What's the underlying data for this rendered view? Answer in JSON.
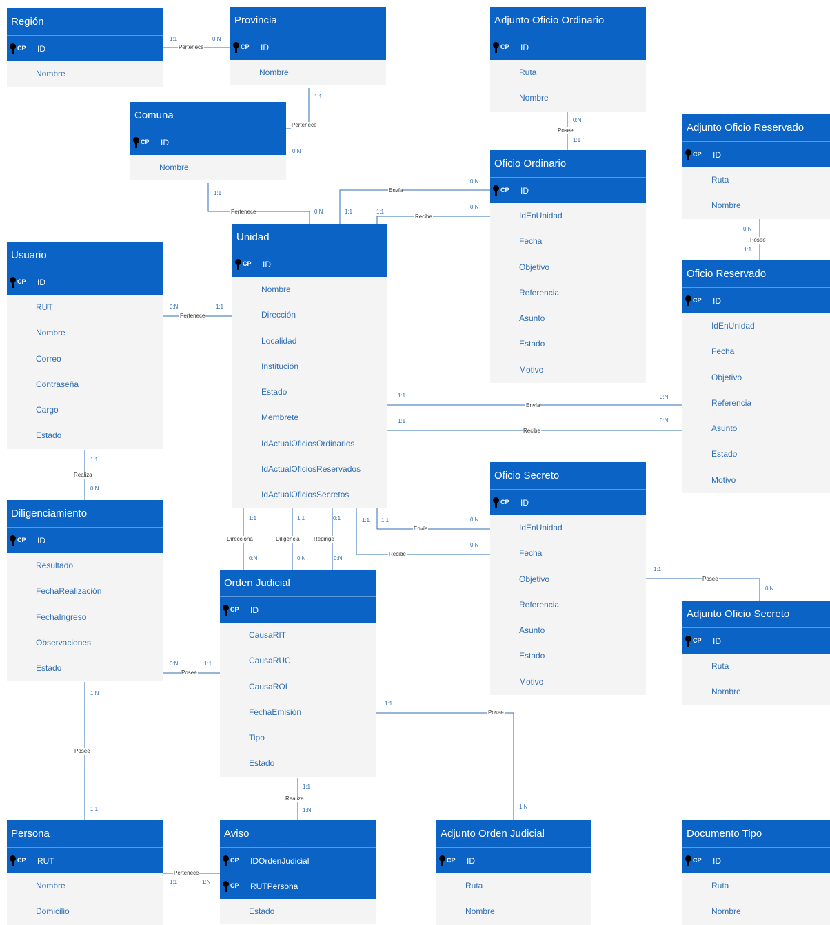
{
  "entities": [
    {
      "id": "region",
      "title": "Región",
      "pk": [
        "ID"
      ],
      "attrs": [
        "Nombre"
      ]
    },
    {
      "id": "provincia",
      "title": "Provincia",
      "pk": [
        "ID"
      ],
      "attrs": [
        "Nombre"
      ]
    },
    {
      "id": "adj_ord",
      "title": "Adjunto Oficio Ordinario",
      "pk": [
        "ID"
      ],
      "attrs": [
        "Ruta",
        "Nombre"
      ]
    },
    {
      "id": "comuna",
      "title": "Comuna",
      "pk": [
        "ID"
      ],
      "attrs": [
        "Nombre"
      ]
    },
    {
      "id": "adj_res",
      "title": "Adjunto Oficio Reservado",
      "pk": [
        "ID"
      ],
      "attrs": [
        "Ruta",
        "Nombre"
      ]
    },
    {
      "id": "of_ord",
      "title": "Oficio Ordinario",
      "pk": [
        "ID"
      ],
      "attrs": [
        "IdEnUnidad",
        "Fecha",
        "Objetivo",
        "Referencia",
        "Asunto",
        "Estado",
        "Motivo"
      ]
    },
    {
      "id": "unidad",
      "title": "Unidad",
      "pk": [
        "ID"
      ],
      "attrs": [
        "Nombre",
        "Dirección",
        "Localidad",
        "Institución",
        "Estado",
        "Membrete",
        "IdActualOficiosOrdinarios",
        "IdActualOficiosReservados",
        "IdActualOficiosSecretos"
      ]
    },
    {
      "id": "usuario",
      "title": "Usuario",
      "pk": [
        "ID"
      ],
      "attrs": [
        "RUT",
        "Nombre",
        "Correo",
        "Contraseña",
        "Cargo",
        "Estado"
      ]
    },
    {
      "id": "of_res",
      "title": "Oficio Reservado",
      "pk": [
        "ID"
      ],
      "attrs": [
        "IdEnUnidad",
        "Fecha",
        "Objetivo",
        "Referencia",
        "Asunto",
        "Estado",
        "Motivo"
      ]
    },
    {
      "id": "of_sec",
      "title": "Oficio Secreto",
      "pk": [
        "ID"
      ],
      "attrs": [
        "IdEnUnidad",
        "Fecha",
        "Objetivo",
        "Referencia",
        "Asunto",
        "Estado",
        "Motivo"
      ]
    },
    {
      "id": "dilig",
      "title": "Diligenciamiento",
      "pk": [
        "ID"
      ],
      "attrs": [
        "Resultado",
        "FechaRealización",
        "FechaIngreso",
        "Observaciones",
        "Estado"
      ]
    },
    {
      "id": "orden",
      "title": "Orden Judicial",
      "pk": [
        "ID"
      ],
      "attrs": [
        "CausaRIT",
        "CausaRUC",
        "CausaROL",
        "FechaEmisión",
        "Tipo",
        "Estado"
      ]
    },
    {
      "id": "adj_sec",
      "title": "Adjunto Oficio Secreto",
      "pk": [
        "ID"
      ],
      "attrs": [
        "Ruta",
        "Nombre"
      ]
    },
    {
      "id": "persona",
      "title": "Persona",
      "pk": [
        "RUT"
      ],
      "attrs": [
        "Nombre",
        "Domicilio"
      ]
    },
    {
      "id": "aviso",
      "title": "Aviso",
      "pk": [
        "IDOrdenJudicial",
        "RUTPersona"
      ],
      "attrs": [
        "Estado"
      ]
    },
    {
      "id": "adj_orden",
      "title": "Adjunto Orden Judicial",
      "pk": [
        "ID"
      ],
      "attrs": [
        "Ruta",
        "Nombre"
      ]
    },
    {
      "id": "doc_tipo",
      "title": "Documento Tipo",
      "pk": [
        "ID"
      ],
      "attrs": [
        "Ruta",
        "Nombre"
      ]
    }
  ],
  "pk_tag": "CP",
  "relationships": [
    {
      "label": "Pertenece",
      "cards": [
        "1:1",
        "0:N"
      ]
    },
    {
      "label": "Pertenece",
      "cards": [
        "1:1",
        "0:N"
      ]
    },
    {
      "label": "Pertenece",
      "cards": [
        "1:1",
        "0:N"
      ]
    },
    {
      "label": "Posee",
      "cards": [
        "0:N",
        "1:1"
      ]
    },
    {
      "label": "Envía",
      "cards": [
        "1:1",
        "0:N"
      ]
    },
    {
      "label": "Recibe",
      "cards": [
        "1:1",
        "0:N"
      ]
    },
    {
      "label": "Posee",
      "cards": [
        "0:N",
        "1:1"
      ]
    },
    {
      "label": "Pertenece",
      "cards": [
        "0:N",
        "1:1"
      ]
    },
    {
      "label": "Envía",
      "cards": [
        "1:1",
        "0:N"
      ]
    },
    {
      "label": "Recibe",
      "cards": [
        "1:1",
        "0:N"
      ]
    },
    {
      "label": "Realiza",
      "cards": [
        "1:1",
        "0:N"
      ]
    },
    {
      "label": "Envía",
      "cards": [
        "1:1",
        "0:N"
      ]
    },
    {
      "label": "Recibe",
      "cards": [
        "1:1",
        "0:N"
      ]
    },
    {
      "label": "Direcciona",
      "cards": [
        "1:1",
        "0:N"
      ]
    },
    {
      "label": "Diligencia",
      "cards": [
        "1:1",
        "0:N"
      ]
    },
    {
      "label": "Redirige",
      "cards": [
        "0:1",
        "0:N"
      ]
    },
    {
      "label": "Posee",
      "cards": [
        "1:1",
        "0:N"
      ]
    },
    {
      "label": "Posee",
      "cards": [
        "0:N",
        "1:1"
      ]
    },
    {
      "label": "Posee",
      "cards": [
        "1:N",
        "1:1"
      ]
    },
    {
      "label": "Posee",
      "cards": [
        "1:1",
        "1:N"
      ]
    },
    {
      "label": "Realiza",
      "cards": [
        "1:1",
        "1:N"
      ]
    },
    {
      "label": "Pertenece",
      "cards": [
        "1:1",
        "1:N"
      ]
    }
  ]
}
